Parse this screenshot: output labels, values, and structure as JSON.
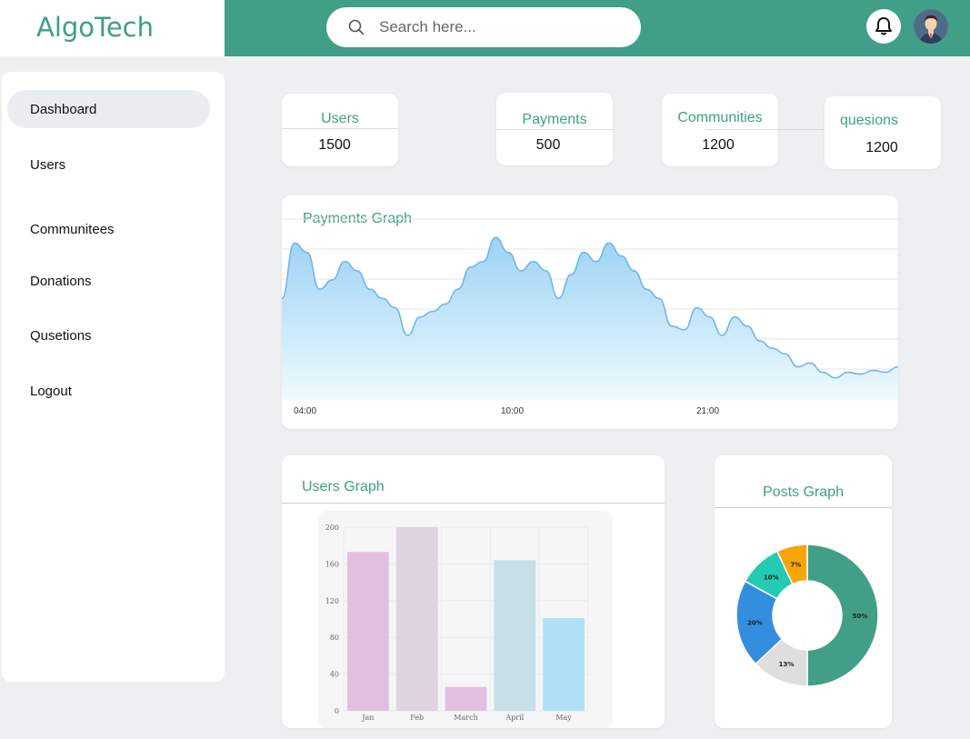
{
  "app": {
    "logo": "AlgoTech"
  },
  "header": {
    "search_placeholder": "Search here..."
  },
  "sidebar": {
    "items": [
      {
        "label": "Dashboard",
        "active": true
      },
      {
        "label": "Users"
      },
      {
        "label": "Communitees"
      },
      {
        "label": "Donations"
      },
      {
        "label": "Qusetions"
      },
      {
        "label": "Logout"
      }
    ]
  },
  "stats": [
    {
      "title": "Users",
      "value": "1500"
    },
    {
      "title": "Payments",
      "value": "500"
    },
    {
      "title": "Communities",
      "value": "1200"
    },
    {
      "title": "quesions",
      "value": "1200"
    }
  ],
  "payments_graph": {
    "title": "Payments Graph",
    "x_labels": [
      "04:00",
      "10:00",
      "21:00"
    ]
  },
  "users_graph": {
    "title": "Users Graph"
  },
  "posts_graph": {
    "title": "Posts Graph"
  },
  "chart_data": [
    {
      "type": "area",
      "title": "Payments Graph",
      "x_tick_labels": [
        "04:00",
        "10:00",
        "21:00"
      ],
      "color": "#6fb6ee",
      "values": [
        55,
        85,
        80,
        60,
        65,
        75,
        70,
        60,
        55,
        50,
        35,
        45,
        48,
        52,
        60,
        72,
        75,
        88,
        80,
        70,
        75,
        70,
        55,
        68,
        80,
        75,
        85,
        78,
        70,
        60,
        55,
        40,
        38,
        50,
        45,
        35,
        45,
        40,
        32,
        28,
        25,
        18,
        20,
        15,
        12,
        15,
        14,
        16,
        15,
        18
      ],
      "grid": true
    },
    {
      "type": "bar",
      "title": "Users Graph",
      "categories": [
        "Jan",
        "Feb",
        "March",
        "April",
        "May"
      ],
      "values": [
        173,
        200,
        26,
        164,
        101
      ],
      "colors": [
        "#e1c0df",
        "#ddd4e0",
        "#e1c0df",
        "#c7dfe8",
        "#b0e0f7"
      ],
      "ylim": [
        0,
        200
      ],
      "y_ticks": [
        0,
        40,
        80,
        120,
        160,
        200
      ],
      "grid": true
    },
    {
      "type": "pie",
      "title": "Posts Graph",
      "donut": true,
      "labels": [
        "50%",
        "13%",
        "20%",
        "10%",
        "7%"
      ],
      "values": [
        50,
        13,
        20,
        10,
        7
      ],
      "colors": [
        "#419f87",
        "#dedede",
        "#348ee0",
        "#22cbb1",
        "#f8a50a"
      ]
    }
  ]
}
